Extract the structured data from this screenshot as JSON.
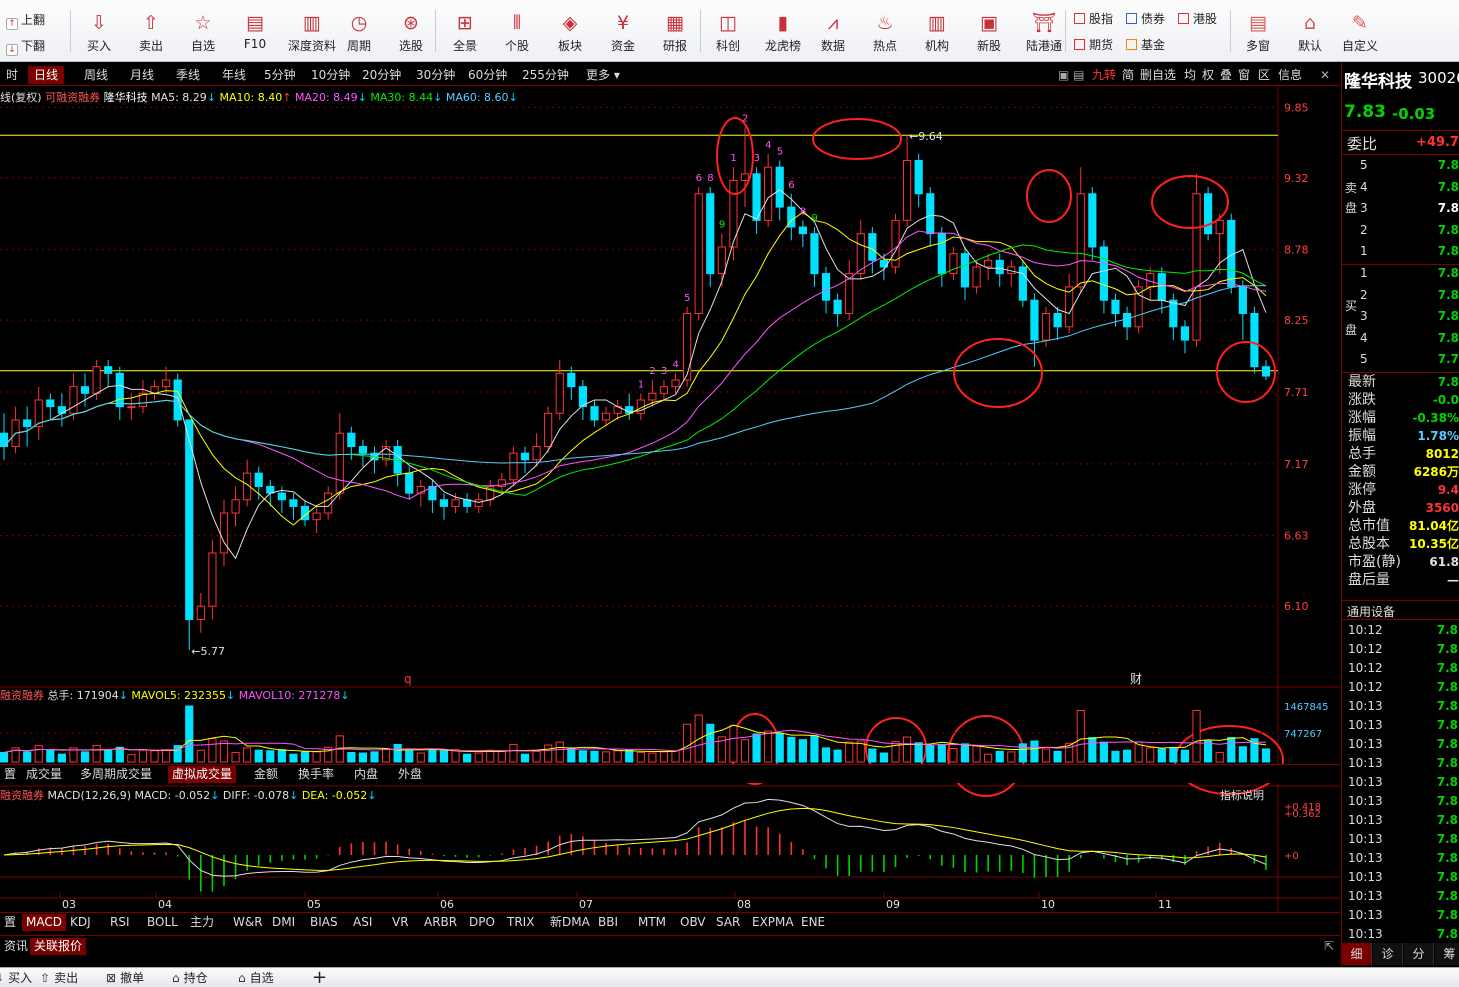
{
  "toolbar": {
    "page_up": "上翻",
    "page_down": "下翻",
    "buttons": [
      {
        "label": "买入",
        "icon": "buy-icon",
        "glyph": "⇩"
      },
      {
        "label": "卖出",
        "icon": "sell-icon",
        "glyph": "⇧"
      },
      {
        "label": "自选",
        "icon": "star-icon",
        "glyph": "☆"
      },
      {
        "label": "F10",
        "icon": "f10-icon",
        "glyph": "▤"
      },
      {
        "label": "深度资料",
        "icon": "f9-icon",
        "glyph": "▥"
      },
      {
        "label": "周期",
        "icon": "clock-icon",
        "glyph": "◷"
      },
      {
        "label": "选股",
        "icon": "stock-picker-icon",
        "glyph": "⊛"
      },
      {
        "label": "全景",
        "icon": "panorama-icon",
        "glyph": "⊞"
      },
      {
        "label": "个股",
        "icon": "candlestick-icon",
        "glyph": "⫴"
      },
      {
        "label": "板块",
        "icon": "layers-icon",
        "glyph": "◈"
      },
      {
        "label": "资金",
        "icon": "yuan-icon",
        "glyph": "¥"
      },
      {
        "label": "研报",
        "icon": "report-icon",
        "glyph": "▦"
      },
      {
        "label": "科创",
        "icon": "sci-tech-icon",
        "glyph": "◫"
      },
      {
        "label": "龙虎榜",
        "icon": "ranking-icon",
        "glyph": "▮"
      },
      {
        "label": "数据",
        "icon": "data-chart-icon",
        "glyph": "⩘"
      },
      {
        "label": "热点",
        "icon": "flame-icon",
        "glyph": "♨"
      },
      {
        "label": "机构",
        "icon": "institution-icon",
        "glyph": "▥"
      },
      {
        "label": "新股",
        "icon": "ipo-icon",
        "glyph": "▣"
      },
      {
        "label": "陆港通",
        "icon": "hk-connect-icon",
        "glyph": "⛩"
      }
    ],
    "mini": [
      {
        "label": "股指",
        "icon": "index-futures-icon",
        "color": "#d33"
      },
      {
        "label": "债券",
        "icon": "bond-icon",
        "color": "#36c"
      },
      {
        "label": "港股",
        "icon": "hk-stock-icon",
        "color": "#d33"
      },
      {
        "label": "期货",
        "icon": "futures-icon",
        "color": "#d33"
      },
      {
        "label": "基金",
        "icon": "fund-icon",
        "color": "#e80"
      }
    ],
    "right_buttons": [
      {
        "label": "多窗",
        "icon": "multi-window-icon",
        "glyph": "▤"
      },
      {
        "label": "默认",
        "icon": "home-icon",
        "glyph": "⌂"
      },
      {
        "label": "自定义",
        "icon": "custom-layout-icon",
        "glyph": "✎"
      }
    ]
  },
  "periods": [
    "时",
    "日线",
    "周线",
    "月线",
    "季线",
    "年线",
    "5分钟",
    "10分钟",
    "20分钟",
    "30分钟",
    "60分钟",
    "255分钟",
    "更多"
  ],
  "active_period": "日线",
  "right_tools": [
    "九转",
    "简",
    "删自选",
    "均",
    "权",
    "叠",
    "窗",
    "区",
    "信息"
  ],
  "stock": {
    "name": "隆华科技",
    "code": "30026",
    "price": "7.83",
    "change": "-0.03",
    "commission_label": "委比",
    "commission_value": "+49.70"
  },
  "main_legend": {
    "prefix": "线(复权)",
    "margin": "可融资融券",
    "name": "隆华科技",
    "ma": [
      {
        "label": "MA5: 8.29",
        "arrow": "↓",
        "color": "#e0e0e0"
      },
      {
        "label": "MA10: 8.40",
        "arrow": "↑",
        "color": "#ffff00"
      },
      {
        "label": "MA20: 8.49",
        "arrow": "↓",
        "color": "#ff55ff"
      },
      {
        "label": "MA30: 8.44",
        "arrow": "↓",
        "color": "#00ee00"
      },
      {
        "label": "MA60: 8.60",
        "arrow": "↓",
        "color": "#55ccff"
      }
    ]
  },
  "price_axis": [
    "9.85",
    "9.32",
    "8.78",
    "8.25",
    "7.71",
    "7.17",
    "6.63",
    "6.10"
  ],
  "annotations": {
    "high": "9.64",
    "low": "5.77",
    "q_mark": "q",
    "finance_mark": "财"
  },
  "vol_legend": {
    "prefix": "融资融券",
    "items": [
      {
        "label": "总手: 171904",
        "arrow": "↓",
        "color": "#e0e0e0"
      },
      {
        "label": "MAVOL5: 232355",
        "arrow": "↓",
        "color": "#ffff00"
      },
      {
        "label": "MAVOL10: 271278",
        "arrow": "↓",
        "color": "#ff55ff"
      }
    ]
  },
  "vol_axis": [
    "1467845",
    "747267"
  ],
  "vol_tabs": [
    "置",
    "成交量",
    "多周期成交量",
    "虚拟成交量",
    "金额",
    "换手率",
    "内盘",
    "外盘"
  ],
  "vol_active": "虚拟成交量",
  "macd_legend": {
    "prefix": "融资融券",
    "params": "MACD(12,26,9)",
    "items": [
      {
        "label": "MACD: -0.052",
        "arrow": "↓",
        "color": "#e0e0e0"
      },
      {
        "label": "DIFF: -0.078",
        "arrow": "↓",
        "color": "#e0e0e0"
      },
      {
        "label": "DEA: -0.052",
        "arrow": "↓",
        "color": "#ffff00"
      }
    ],
    "explain": "指标说明"
  },
  "macd_axis": [
    "+0.418",
    "+0.362",
    "+0"
  ],
  "months": [
    "03",
    "04",
    "05",
    "06",
    "07",
    "08",
    "09",
    "10",
    "11"
  ],
  "indicator_tabs": [
    "置",
    "MACD",
    "KDJ",
    "RSI",
    "BOLL",
    "主力",
    "W&R",
    "DMI",
    "BIAS",
    "ASI",
    "VR",
    "ARBR",
    "DPO",
    "TRIX",
    "新DMA",
    "BBI",
    "MTM",
    "OBV",
    "SAR",
    "EXPMA",
    "ENE"
  ],
  "indicator_active": "MACD",
  "info_tabs": [
    "资讯",
    "关联报价"
  ],
  "info_active": "关联报价",
  "order_book": {
    "sell_label": "卖盘",
    "buy_label": "买盘",
    "sell": [
      {
        "n": "5",
        "p": "7.8"
      },
      {
        "n": "4",
        "p": "7.8"
      },
      {
        "n": "3",
        "p": "7.8"
      },
      {
        "n": "2",
        "p": "7.8"
      },
      {
        "n": "1",
        "p": "7.8"
      }
    ],
    "buy": [
      {
        "n": "1",
        "p": "7.8"
      },
      {
        "n": "2",
        "p": "7.8"
      },
      {
        "n": "3",
        "p": "7.8"
      },
      {
        "n": "4",
        "p": "7.8"
      },
      {
        "n": "5",
        "p": "7.7"
      }
    ]
  },
  "stats": [
    {
      "label": "最新",
      "value": "7.8",
      "color": "#00d400"
    },
    {
      "label": "涨跌",
      "value": "-0.0",
      "color": "#00d400"
    },
    {
      "label": "涨幅",
      "value": "-0.38%",
      "color": "#00d400"
    },
    {
      "label": "振幅",
      "value": "1.78%",
      "color": "#55ccff"
    },
    {
      "label": "总手",
      "value": "8012",
      "color": "#ffff00"
    },
    {
      "label": "金额",
      "value": "6286万",
      "color": "#ffff00"
    },
    {
      "label": "涨停",
      "value": "9.4",
      "color": "#ff3333"
    },
    {
      "label": "外盘",
      "value": "3560",
      "color": "#ff3333"
    },
    {
      "label": "总市值",
      "value": "81.04亿",
      "color": "#ffff00"
    },
    {
      "label": "总股本",
      "value": "10.35亿",
      "color": "#ffff00"
    },
    {
      "label": "市盈(静)",
      "value": "61.8",
      "color": "#e0e0e0"
    },
    {
      "label": "盘后量",
      "value": "—",
      "color": "#e0e0e0"
    }
  ],
  "tick_header": "通用设备",
  "ticks": [
    {
      "t": "10:12",
      "p": "7.8"
    },
    {
      "t": "10:12",
      "p": "7.8"
    },
    {
      "t": "10:12",
      "p": "7.8"
    },
    {
      "t": "10:12",
      "p": "7.8"
    },
    {
      "t": "10:13",
      "p": "7.8"
    },
    {
      "t": "10:13",
      "p": "7.8"
    },
    {
      "t": "10:13",
      "p": "7.8"
    },
    {
      "t": "10:13",
      "p": "7.8"
    },
    {
      "t": "10:13",
      "p": "7.8"
    },
    {
      "t": "10:13",
      "p": "7.8"
    },
    {
      "t": "10:13",
      "p": "7.8"
    },
    {
      "t": "10:13",
      "p": "7.8"
    },
    {
      "t": "10:13",
      "p": "7.8"
    },
    {
      "t": "10:13",
      "p": "7.8"
    },
    {
      "t": "10:13",
      "p": "7.8"
    },
    {
      "t": "10:13",
      "p": "7.8"
    },
    {
      "t": "10:13",
      "p": "7.8"
    }
  ],
  "right_tabs": [
    "细",
    "诊",
    "分",
    "筹"
  ],
  "right_active": "细",
  "bottom": [
    {
      "label": "买入",
      "icon": "buy-icon",
      "glyph": "⇩"
    },
    {
      "label": "卖出",
      "icon": "sell-icon",
      "glyph": "⇧"
    },
    {
      "label": "撤单",
      "icon": "cancel-order-icon",
      "glyph": "⊠"
    },
    {
      "label": "持仓",
      "icon": "holdings-icon",
      "glyph": "⌂"
    },
    {
      "label": "自选",
      "icon": "watchlist-icon",
      "glyph": "⌂"
    },
    {
      "label": "+",
      "icon": "add-icon",
      "glyph": ""
    }
  ],
  "chart_data": {
    "type": "candlestick",
    "price_range": [
      5.5,
      9.95
    ],
    "date_range": [
      "03",
      "11"
    ],
    "resistance": 9.64,
    "support": 7.87,
    "candles": [
      [
        7.4,
        7.3,
        7.55,
        7.2
      ],
      [
        7.3,
        7.5,
        7.6,
        7.25
      ],
      [
        7.5,
        7.45,
        7.6,
        7.3
      ],
      [
        7.45,
        7.65,
        7.75,
        7.35
      ],
      [
        7.65,
        7.6,
        7.7,
        7.5
      ],
      [
        7.6,
        7.55,
        7.7,
        7.45
      ],
      [
        7.55,
        7.75,
        7.85,
        7.5
      ],
      [
        7.75,
        7.7,
        7.85,
        7.6
      ],
      [
        7.7,
        7.9,
        7.95,
        7.65
      ],
      [
        7.9,
        7.85,
        7.95,
        7.75
      ],
      [
        7.85,
        7.6,
        7.9,
        7.5
      ],
      [
        7.6,
        7.6,
        7.7,
        7.5
      ],
      [
        7.6,
        7.7,
        7.8,
        7.55
      ],
      [
        7.7,
        7.75,
        7.8,
        7.65
      ],
      [
        7.75,
        7.8,
        7.9,
        7.7
      ],
      [
        7.8,
        7.5,
        7.85,
        7.45
      ],
      [
        7.5,
        6.0,
        7.5,
        5.77
      ],
      [
        6.0,
        6.1,
        6.2,
        5.9
      ],
      [
        6.1,
        6.5,
        6.6,
        6.0
      ],
      [
        6.5,
        6.8,
        6.9,
        6.4
      ],
      [
        6.8,
        6.9,
        7.0,
        6.7
      ],
      [
        6.9,
        7.1,
        7.2,
        6.85
      ],
      [
        7.1,
        7.0,
        7.15,
        6.9
      ],
      [
        7.0,
        6.95,
        7.05,
        6.85
      ],
      [
        6.95,
        6.9,
        7.0,
        6.8
      ],
      [
        6.9,
        6.85,
        6.95,
        6.75
      ],
      [
        6.85,
        6.75,
        6.9,
        6.7
      ],
      [
        6.75,
        6.8,
        6.85,
        6.65
      ],
      [
        6.8,
        6.95,
        7.0,
        6.75
      ],
      [
        6.95,
        7.4,
        7.55,
        6.9
      ],
      [
        7.4,
        7.3,
        7.45,
        7.2
      ],
      [
        7.3,
        7.25,
        7.35,
        7.15
      ],
      [
        7.25,
        7.2,
        7.3,
        7.1
      ],
      [
        7.2,
        7.3,
        7.35,
        7.15
      ],
      [
        7.3,
        7.1,
        7.35,
        7.0
      ],
      [
        7.1,
        6.95,
        7.15,
        6.9
      ],
      [
        6.95,
        7.0,
        7.05,
        6.85
      ],
      [
        7.0,
        6.9,
        7.05,
        6.8
      ],
      [
        6.9,
        6.85,
        6.95,
        6.75
      ],
      [
        6.85,
        6.9,
        6.95,
        6.8
      ],
      [
        6.9,
        6.85,
        6.95,
        6.8
      ],
      [
        6.85,
        6.9,
        6.95,
        6.8
      ],
      [
        6.9,
        7.0,
        7.05,
        6.85
      ],
      [
        7.0,
        7.05,
        7.1,
        6.95
      ],
      [
        7.05,
        7.25,
        7.3,
        7.0
      ],
      [
        7.25,
        7.2,
        7.3,
        7.1
      ],
      [
        7.2,
        7.3,
        7.4,
        7.15
      ],
      [
        7.3,
        7.55,
        7.6,
        7.25
      ],
      [
        7.55,
        7.85,
        7.95,
        7.5
      ],
      [
        7.85,
        7.75,
        7.9,
        7.65
      ],
      [
        7.75,
        7.6,
        7.8,
        7.5
      ],
      [
        7.6,
        7.5,
        7.65,
        7.45
      ],
      [
        7.5,
        7.55,
        7.6,
        7.45
      ],
      [
        7.55,
        7.6,
        7.65,
        7.5
      ],
      [
        7.6,
        7.55,
        7.7,
        7.5
      ],
      [
        7.55,
        7.65,
        7.7,
        7.5
      ],
      [
        7.65,
        7.7,
        7.8,
        7.6
      ],
      [
        7.7,
        7.75,
        7.8,
        7.65
      ],
      [
        7.75,
        7.8,
        7.85,
        7.7
      ],
      [
        7.8,
        8.3,
        8.35,
        7.75
      ],
      [
        8.3,
        9.2,
        9.25,
        8.25
      ],
      [
        9.2,
        8.6,
        9.25,
        8.5
      ],
      [
        8.6,
        8.8,
        8.9,
        8.5
      ],
      [
        8.8,
        9.3,
        9.4,
        8.7
      ],
      [
        9.3,
        9.35,
        9.7,
        9.1
      ],
      [
        9.35,
        9.0,
        9.4,
        8.9
      ],
      [
        9.0,
        9.4,
        9.5,
        8.95
      ],
      [
        9.4,
        9.1,
        9.45,
        9.0
      ],
      [
        9.1,
        8.95,
        9.2,
        8.85
      ],
      [
        8.95,
        8.9,
        9.0,
        8.8
      ],
      [
        8.9,
        8.6,
        8.95,
        8.5
      ],
      [
        8.6,
        8.4,
        8.65,
        8.3
      ],
      [
        8.4,
        8.3,
        8.45,
        8.2
      ],
      [
        8.3,
        8.6,
        8.7,
        8.25
      ],
      [
        8.6,
        8.9,
        9.0,
        8.55
      ],
      [
        8.9,
        8.7,
        8.95,
        8.6
      ],
      [
        8.7,
        8.65,
        8.75,
        8.55
      ],
      [
        8.65,
        9.0,
        9.05,
        8.6
      ],
      [
        9.0,
        9.45,
        9.64,
        8.95
      ],
      [
        9.45,
        9.2,
        9.5,
        9.1
      ],
      [
        9.2,
        8.9,
        9.25,
        8.8
      ],
      [
        8.9,
        8.6,
        8.95,
        8.5
      ],
      [
        8.6,
        8.75,
        8.8,
        8.55
      ],
      [
        8.75,
        8.5,
        8.8,
        8.4
      ],
      [
        8.5,
        8.65,
        8.7,
        8.45
      ],
      [
        8.65,
        8.7,
        8.75,
        8.55
      ],
      [
        8.7,
        8.6,
        8.75,
        8.5
      ],
      [
        8.6,
        8.65,
        8.7,
        8.5
      ],
      [
        8.65,
        8.4,
        8.7,
        8.35
      ],
      [
        8.4,
        8.1,
        8.45,
        7.9
      ],
      [
        8.1,
        8.3,
        8.35,
        8.05
      ],
      [
        8.3,
        8.2,
        8.35,
        8.1
      ],
      [
        8.2,
        8.5,
        8.6,
        8.15
      ],
      [
        8.5,
        9.2,
        9.4,
        8.45
      ],
      [
        9.2,
        8.8,
        9.25,
        8.7
      ],
      [
        8.8,
        8.4,
        8.85,
        8.3
      ],
      [
        8.4,
        8.3,
        8.45,
        8.2
      ],
      [
        8.3,
        8.2,
        8.35,
        8.1
      ],
      [
        8.2,
        8.5,
        8.55,
        8.15
      ],
      [
        8.5,
        8.6,
        8.65,
        8.4
      ],
      [
        8.6,
        8.4,
        8.65,
        8.3
      ],
      [
        8.4,
        8.2,
        8.45,
        8.1
      ],
      [
        8.2,
        8.1,
        8.25,
        8.0
      ],
      [
        8.1,
        9.2,
        9.35,
        8.05
      ],
      [
        9.2,
        8.9,
        9.25,
        8.85
      ],
      [
        8.9,
        9.0,
        9.05,
        8.6
      ],
      [
        9.0,
        8.5,
        9.05,
        8.45
      ],
      [
        8.5,
        8.3,
        8.55,
        8.1
      ],
      [
        8.3,
        7.9,
        8.35,
        7.85
      ],
      [
        7.9,
        7.83,
        7.95,
        7.8
      ]
    ],
    "volume_unit": "手",
    "volume_max": 1467845,
    "macd_range": [
      -0.35,
      0.5
    ]
  }
}
